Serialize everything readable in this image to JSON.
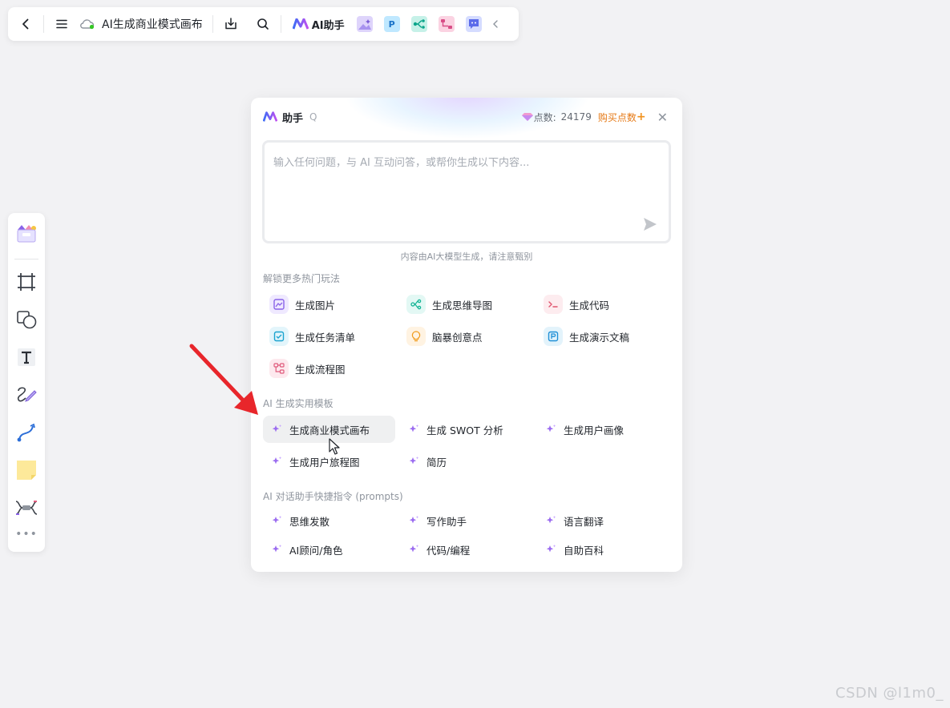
{
  "toolbar": {
    "doc_title": "AI生成商业模式画布",
    "ai_label": "AI助手",
    "apps": [
      {
        "name": "image-app",
        "glyph": "",
        "color": "#c7b9f5",
        "fg": "#7b5cd6"
      },
      {
        "name": "ppt-app",
        "glyph": "P",
        "color": "#7fd3ff",
        "fg": "#1a73c8"
      },
      {
        "name": "mindmap-app",
        "glyph": "⋮",
        "color": "#7de3d1",
        "fg": "#0aa58a"
      },
      {
        "name": "flow-app",
        "glyph": "",
        "color": "#f7b6cf",
        "fg": "#d84d86"
      },
      {
        "name": "chat-app",
        "glyph": "",
        "color": "#a7b6ff",
        "fg": "#4f5fe0"
      }
    ]
  },
  "panel": {
    "title": "助手",
    "title_suffix": "Q",
    "points_label": "点数:",
    "points_value": "24179",
    "buy_label": "购买点数",
    "input_placeholder": "输入任何问题，与 AI 互动问答，或帮你生成以下内容...",
    "notice": "内容由AI大模型生成，请注意甄别",
    "section1": "解锁更多热门玩法",
    "features": [
      {
        "label": "生成图片",
        "icon": "image-icon",
        "bg": "#efe9ff",
        "fg": "#8a63e8"
      },
      {
        "label": "生成思维导图",
        "icon": "mindmap-icon",
        "bg": "#e3f8f4",
        "fg": "#14b495"
      },
      {
        "label": "生成代码",
        "icon": "code-icon",
        "bg": "#fdecef",
        "fg": "#e0546e"
      },
      {
        "label": "生成任务清单",
        "icon": "checklist-icon",
        "bg": "#e3f5fb",
        "fg": "#1aa3cf"
      },
      {
        "label": "脑暴创意点",
        "icon": "lightbulb-icon",
        "bg": "#fff3e2",
        "fg": "#f09a1a"
      },
      {
        "label": "生成演示文稿",
        "icon": "presentation-icon",
        "bg": "#e3f3fb",
        "fg": "#1f8fd6"
      },
      {
        "label": "生成流程图",
        "icon": "flowchart-icon",
        "bg": "#fde9ee",
        "fg": "#e05a7c"
      }
    ],
    "section2": "AI 生成实用模板",
    "templates": [
      "生成商业模式画布",
      "生成 SWOT 分析",
      "生成用户画像",
      "生成用户旅程图",
      "简历"
    ],
    "section3": "AI 对话助手快捷指令 (prompts)",
    "prompts": [
      "思维发散",
      "写作助手",
      "语言翻译",
      "AI顾问/角色",
      "代码/编程",
      "自助百科"
    ]
  },
  "watermark": "CSDN @l1m0_",
  "colors": {
    "accent": "#7b4ff0",
    "buy": "#e67a17",
    "annotation": "#e8262b"
  }
}
